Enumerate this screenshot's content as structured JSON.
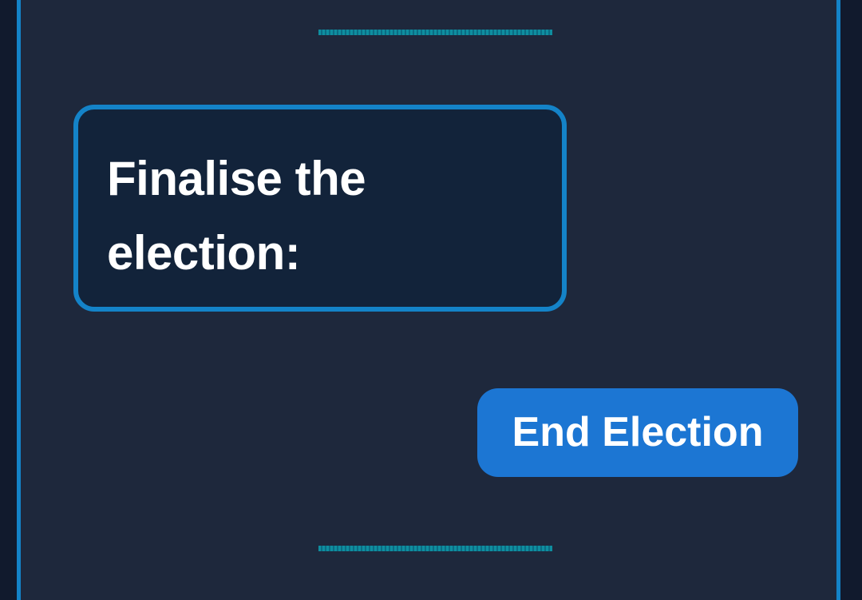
{
  "finalise": {
    "prompt": "Finalise the election:",
    "button_label": "End Election"
  },
  "colors": {
    "background": "#1e283c",
    "accent_border": "#1483c8",
    "card_fill": "#12233a",
    "button": "#1c76d3",
    "divider": "#0f8e9f",
    "text": "#ffffff"
  }
}
